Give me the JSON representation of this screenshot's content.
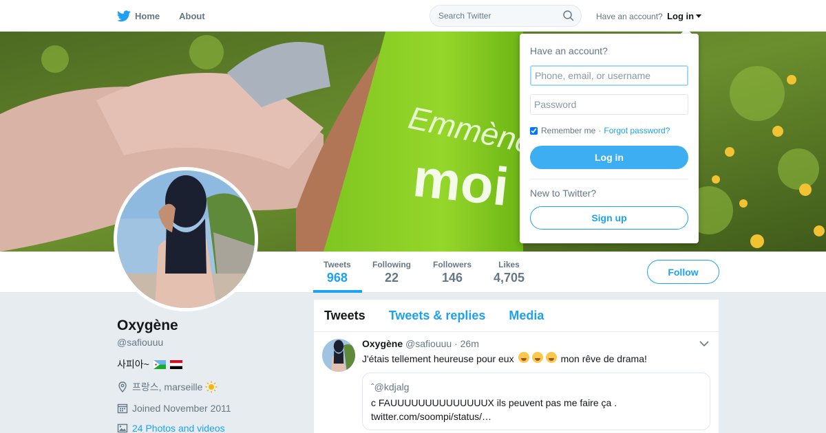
{
  "nav": {
    "home_label": "Home",
    "about_label": "About",
    "search_placeholder": "Search Twitter",
    "have_account_text": "Have an account?",
    "login_label": "Log in"
  },
  "banner": {
    "bottle_text_line1": "Emmène",
    "bottle_text_line2": "moi"
  },
  "stats": [
    {
      "label": "Tweets",
      "value": "968"
    },
    {
      "label": "Following",
      "value": "22"
    },
    {
      "label": "Followers",
      "value": "146"
    },
    {
      "label": "Likes",
      "value": "4,705"
    }
  ],
  "follow_label": "Follow",
  "profile": {
    "name": "Oxygène",
    "handle": "@safiouuu",
    "bio": "사피아~",
    "location": "프랑스, marseille",
    "joined": "Joined November 2011",
    "photos_link": "24 Photos and videos"
  },
  "tabs": [
    "Tweets",
    "Tweets & replies",
    "Media"
  ],
  "tweet": {
    "name": "Oxygène",
    "handle": "@safiouuu",
    "time": "· 26m",
    "text_before": "J'étais tellement heureuse pour eux",
    "text_after": "mon rêve de drama!",
    "quote_handle": "ˆ@kdjalg",
    "quote_text": "c FAUUUUUUUUUUUUUUX ils peuvent pas me faire ça . twitter.com/soompi/status/…"
  },
  "dropdown": {
    "title": "Have an account?",
    "username_placeholder": "Phone, email, or username",
    "password_placeholder": "Password",
    "remember_label": "Remember me",
    "separator": "·",
    "forgot_label": "Forgot password?",
    "login_button": "Log in",
    "new_text": "New to Twitter?",
    "signup_button": "Sign up"
  },
  "colors": {
    "accent": "#1da1f2",
    "background": "#e6ecf0",
    "text_secondary": "#657786"
  }
}
